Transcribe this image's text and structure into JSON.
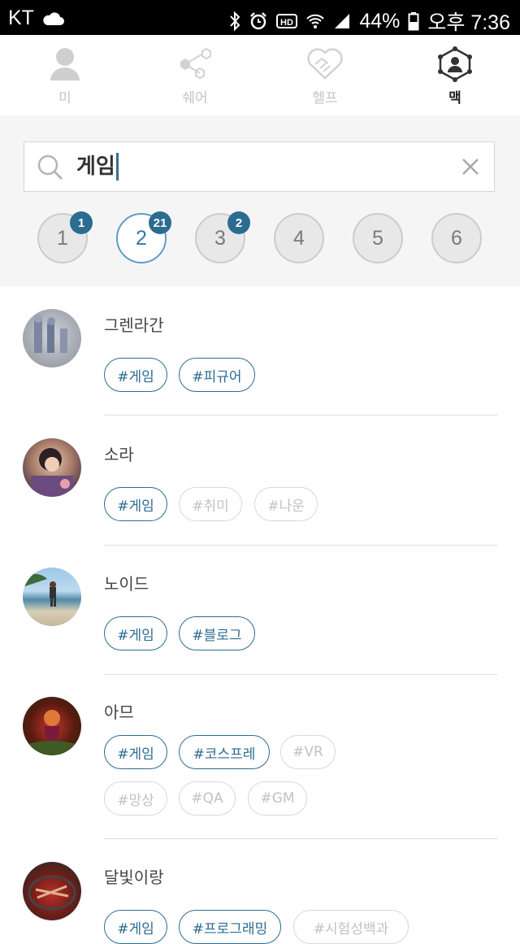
{
  "status_bar": {
    "carrier": "KT",
    "battery": "44%",
    "time": "오후 7:36"
  },
  "tabs": [
    {
      "label": "미",
      "icon": "person-icon",
      "active": false
    },
    {
      "label": "쉐어",
      "icon": "share-icon",
      "active": false
    },
    {
      "label": "헬프",
      "icon": "handshake-icon",
      "active": false
    },
    {
      "label": "맥",
      "icon": "network-icon",
      "active": true
    }
  ],
  "search": {
    "query": "게임"
  },
  "pages": [
    {
      "num": "1",
      "badge": "1",
      "active": false
    },
    {
      "num": "2",
      "badge": "21",
      "active": true
    },
    {
      "num": "3",
      "badge": "2",
      "active": false
    },
    {
      "num": "4",
      "badge": "",
      "active": false
    },
    {
      "num": "5",
      "badge": "",
      "active": false
    },
    {
      "num": "6",
      "badge": "",
      "active": false
    }
  ],
  "results": [
    {
      "name": "그렌라간",
      "tags": [
        {
          "text": "#게임",
          "on": true
        },
        {
          "text": "#피규어",
          "on": true
        }
      ]
    },
    {
      "name": "소라",
      "tags": [
        {
          "text": "#게임",
          "on": true
        },
        {
          "text": "#취미",
          "on": false
        },
        {
          "text": "#나운",
          "on": false
        }
      ]
    },
    {
      "name": "노이드",
      "tags": [
        {
          "text": "#게임",
          "on": true
        },
        {
          "text": "#블로그",
          "on": true
        }
      ]
    },
    {
      "name": "아므",
      "tags": [
        {
          "text": "#게임",
          "on": true
        },
        {
          "text": "#코스프레",
          "on": true
        },
        {
          "text": "#VR",
          "on": false
        },
        {
          "text": "#망상",
          "on": false
        },
        {
          "text": "#QA",
          "on": false
        },
        {
          "text": "#GM",
          "on": false
        }
      ]
    },
    {
      "name": "달빛이랑",
      "tags": [
        {
          "text": "#게임",
          "on": true
        },
        {
          "text": "#프로그래밍",
          "on": true
        },
        {
          "text": "#시험성백과",
          "on": false
        }
      ]
    }
  ]
}
